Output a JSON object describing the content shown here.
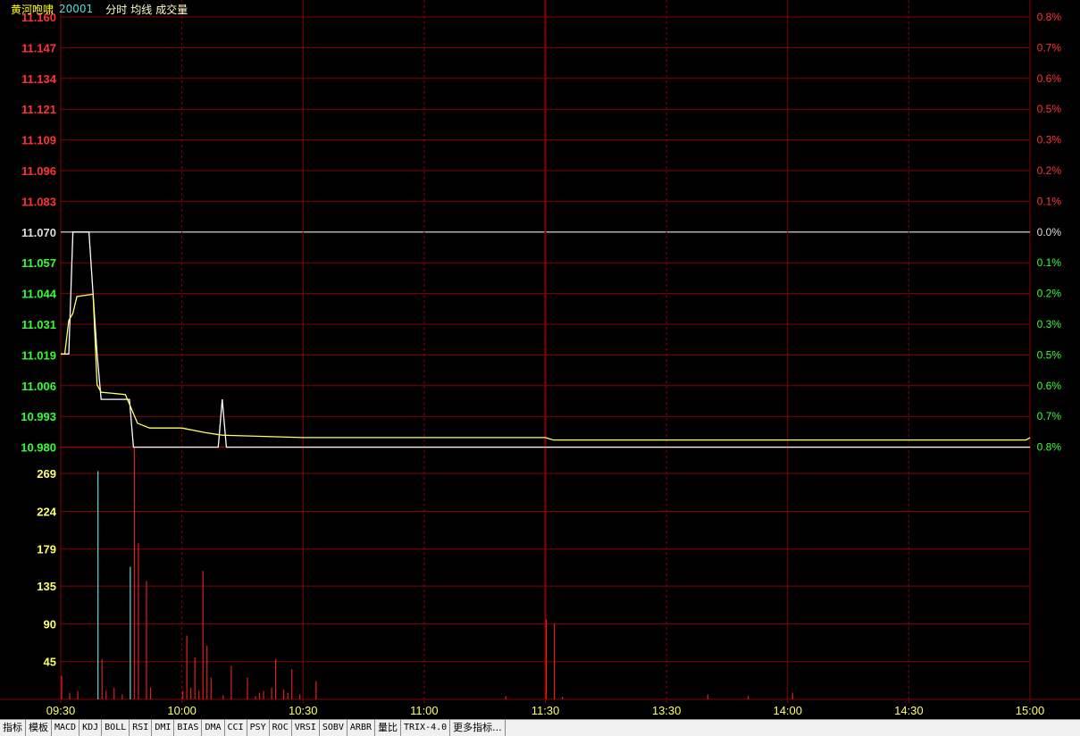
{
  "header": {
    "stock_name": "黄河咆啸",
    "stock_code": "20001",
    "items": [
      "分时",
      "均线",
      "成交量"
    ]
  },
  "colors": {
    "background": "#000000",
    "grid": "#8b0000",
    "price_line": "#ffffff",
    "avg_line": "#ffff66",
    "up": "#ff3333",
    "down": "#33ff33",
    "flat": "#dddddd",
    "volume_labels": "#ffff66"
  },
  "chart_data": {
    "type": "line",
    "price_axis": {
      "ticks": [
        "11.160",
        "11.147",
        "11.134",
        "11.121",
        "11.109",
        "11.096",
        "11.083",
        "11.070",
        "11.057",
        "11.044",
        "11.031",
        "11.019",
        "11.006",
        "10.993",
        "10.980"
      ],
      "ylim": [
        10.98,
        11.16
      ],
      "prev_close": 11.07
    },
    "percent_axis": {
      "ticks": [
        "0.8%",
        "0.7%",
        "0.6%",
        "0.5%",
        "0.3%",
        "0.2%",
        "0.1%",
        "0.0%",
        "0.1%",
        "0.2%",
        "0.3%",
        "0.5%",
        "0.6%",
        "0.7%",
        "0.8%"
      ]
    },
    "time_axis": {
      "ticks": [
        "09:30",
        "10:00",
        "10:30",
        "11:00",
        "11:30",
        "13:30",
        "14:00",
        "14:30",
        "15:00"
      ],
      "session_minutes": 240
    },
    "volume_axis": {
      "ticks": [
        "269",
        "224",
        "179",
        "135",
        "90",
        "45"
      ],
      "ylim": [
        0,
        300
      ]
    },
    "series": [
      {
        "name": "分时",
        "points": [
          [
            0,
            11.019
          ],
          [
            2,
            11.019
          ],
          [
            3,
            11.07
          ],
          [
            7,
            11.07
          ],
          [
            8,
            11.044
          ],
          [
            9,
            11.019
          ],
          [
            10,
            11.0
          ],
          [
            17,
            11.0
          ],
          [
            18,
            10.98
          ],
          [
            39,
            10.98
          ],
          [
            40,
            11.0
          ],
          [
            41,
            10.98
          ],
          [
            240,
            10.98
          ]
        ]
      },
      {
        "name": "均线",
        "points": [
          [
            0,
            11.019
          ],
          [
            1,
            11.019
          ],
          [
            2,
            11.033
          ],
          [
            3,
            11.036
          ],
          [
            4,
            11.043
          ],
          [
            8,
            11.044
          ],
          [
            9,
            11.006
          ],
          [
            10,
            11.003
          ],
          [
            16,
            11.002
          ],
          [
            17,
            10.998
          ],
          [
            19,
            10.99
          ],
          [
            22,
            10.988
          ],
          [
            30,
            10.988
          ],
          [
            36,
            10.986
          ],
          [
            40,
            10.985
          ],
          [
            60,
            10.984
          ],
          [
            120,
            10.984
          ],
          [
            122,
            10.983
          ],
          [
            236,
            10.983
          ],
          [
            239,
            10.983
          ],
          [
            240,
            10.984
          ]
        ]
      }
    ],
    "volume": [
      {
        "t": 0,
        "v": 28,
        "c": "up"
      },
      {
        "t": 2,
        "v": 8,
        "c": "up"
      },
      {
        "t": 4,
        "v": 10,
        "c": "up"
      },
      {
        "t": 9,
        "v": 272,
        "c": "down"
      },
      {
        "t": 10,
        "v": 48,
        "c": "up"
      },
      {
        "t": 11,
        "v": 10,
        "c": "up"
      },
      {
        "t": 13,
        "v": 14,
        "c": "up"
      },
      {
        "t": 15,
        "v": 6,
        "c": "up"
      },
      {
        "t": 17,
        "v": 158,
        "c": "down"
      },
      {
        "t": 18,
        "v": 300,
        "c": "up"
      },
      {
        "t": 19,
        "v": 186,
        "c": "up"
      },
      {
        "t": 21,
        "v": 141,
        "c": "up"
      },
      {
        "t": 22,
        "v": 14,
        "c": "up"
      },
      {
        "t": 30,
        "v": 10,
        "c": "up"
      },
      {
        "t": 31,
        "v": 76,
        "c": "up"
      },
      {
        "t": 32,
        "v": 14,
        "c": "up"
      },
      {
        "t": 33,
        "v": 50,
        "c": "up"
      },
      {
        "t": 34,
        "v": 10,
        "c": "up"
      },
      {
        "t": 35,
        "v": 153,
        "c": "up"
      },
      {
        "t": 36,
        "v": 64,
        "c": "up"
      },
      {
        "t": 37,
        "v": 26,
        "c": "up"
      },
      {
        "t": 40,
        "v": 5,
        "c": "up"
      },
      {
        "t": 42,
        "v": 40,
        "c": "up"
      },
      {
        "t": 46,
        "v": 26,
        "c": "up"
      },
      {
        "t": 48,
        "v": 4,
        "c": "up"
      },
      {
        "t": 49,
        "v": 8,
        "c": "up"
      },
      {
        "t": 50,
        "v": 10,
        "c": "up"
      },
      {
        "t": 52,
        "v": 14,
        "c": "up"
      },
      {
        "t": 53,
        "v": 48,
        "c": "up"
      },
      {
        "t": 55,
        "v": 12,
        "c": "up"
      },
      {
        "t": 56,
        "v": 8,
        "c": "up"
      },
      {
        "t": 57,
        "v": 36,
        "c": "up"
      },
      {
        "t": 59,
        "v": 6,
        "c": "up"
      },
      {
        "t": 63,
        "v": 22,
        "c": "up"
      },
      {
        "t": 110,
        "v": 4,
        "c": "up"
      },
      {
        "t": 120,
        "v": 95,
        "c": "up"
      },
      {
        "t": 122,
        "v": 90,
        "c": "up"
      },
      {
        "t": 124,
        "v": 3,
        "c": "up"
      },
      {
        "t": 160,
        "v": 6,
        "c": "up"
      },
      {
        "t": 170,
        "v": 4,
        "c": "up"
      },
      {
        "t": 181,
        "v": 8,
        "c": "up"
      }
    ]
  },
  "tabs": [
    "指标",
    "模板",
    "MACD",
    "KDJ",
    "BOLL",
    "RSI",
    "DMI",
    "BIAS",
    "DMA",
    "CCI",
    "PSY",
    "ROC",
    "VRSI",
    "SOBV",
    "ARBR",
    "量比",
    "TRIX-4.0",
    "更多指标..."
  ]
}
